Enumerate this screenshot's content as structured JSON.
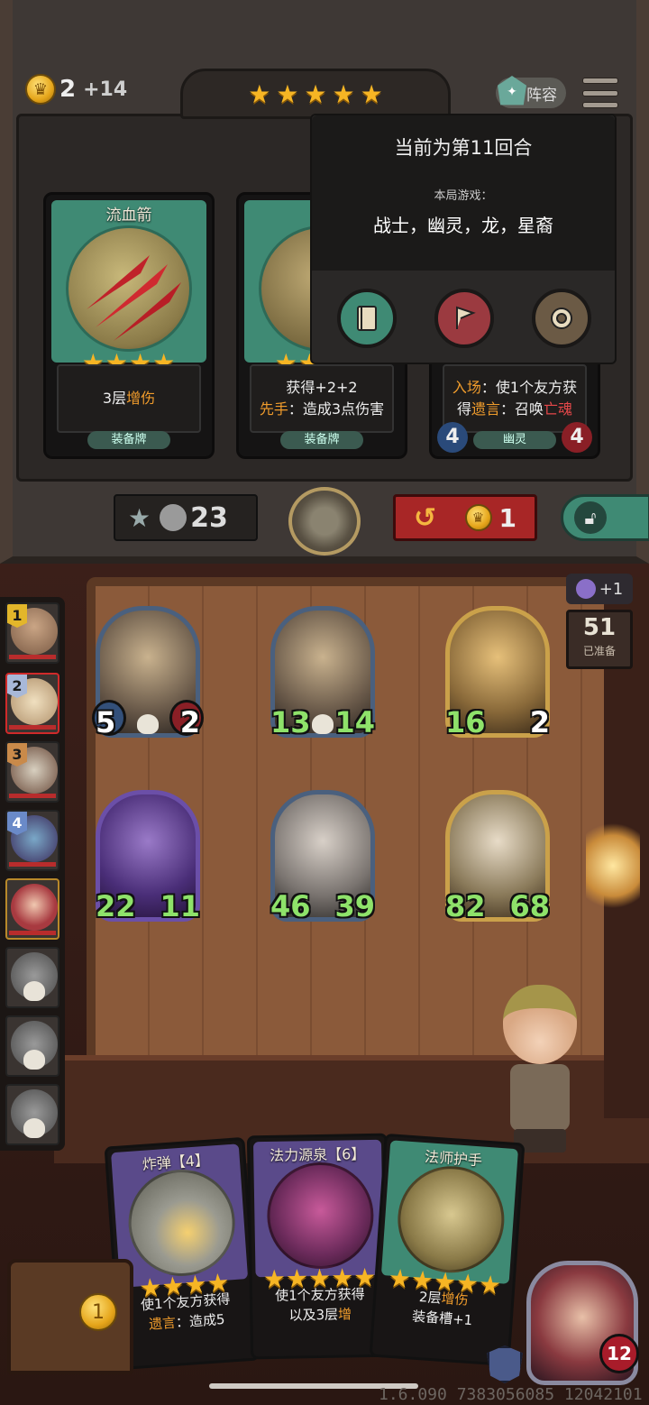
{
  "shop": {
    "gold": "2",
    "gold_income": "+14",
    "tavern_stars": 5,
    "lineup_label": "阵容",
    "cards": [
      {
        "title": "流血箭",
        "stars": 4,
        "desc_line1": "3层",
        "desc_hl1": "增伤",
        "desc_line2": "",
        "tag": "装备牌"
      },
      {
        "title": "",
        "stars": 4,
        "desc_line1": "获得+2+2",
        "desc_hl2": "先手",
        "desc_line2": "：造成3点伤害",
        "tag": "装备牌"
      },
      {
        "title": "",
        "desc_hl1": "入场",
        "desc_line1": "：使1个友方获",
        "desc_pre2": "得",
        "desc_hl2": "遗言",
        "desc_line2": "：召唤",
        "desc_hl3": "亡魂",
        "tag": "幽灵",
        "attack": "4",
        "health": "4"
      }
    ],
    "rank_credits": "23",
    "refresh_cost": "1"
  },
  "popup": {
    "round_text": "当前为第11回合",
    "game_label": "本局游戏：",
    "tribes": "战士，幽灵，龙，星裔"
  },
  "board": {
    "moon_bonus": "+1",
    "prep_count": "51",
    "prep_label": "已准备",
    "players": [
      {
        "rank": "1"
      },
      {
        "rank": "2"
      },
      {
        "rank": "3"
      },
      {
        "rank": "4"
      },
      {
        "rank": ""
      },
      {
        "rank": ""
      },
      {
        "rank": ""
      },
      {
        "rank": ""
      }
    ],
    "minions": [
      {
        "attack": "5",
        "health": "2"
      },
      {
        "attack": "13",
        "health": "14"
      },
      {
        "attack": "16",
        "health": "2"
      },
      {
        "attack": "22",
        "health": "11"
      },
      {
        "attack": "46",
        "health": "39"
      },
      {
        "attack": "82",
        "health": "68"
      }
    ]
  },
  "hand": [
    {
      "title": "炸弹【4】",
      "line1": "使1个友方获得",
      "line2_hl": "遗言",
      "line2": "：造成5"
    },
    {
      "title": "法力源泉【6】",
      "line1": "使1个友方获得",
      "line2": "以及3层",
      "line2_hl": "增"
    },
    {
      "title": "法师护手",
      "line1": "2层",
      "line1_hl": "增伤",
      "line2": "装备槽+1"
    }
  ],
  "chest_count": "1",
  "hero_health": "12",
  "version": "1.6.090 7383056085 12042101",
  "colors": {
    "accent_gold": "#f6b524",
    "highlight": "#f09c2c",
    "shop_green": "#3f8a74",
    "refresh_red": "#a82626"
  }
}
